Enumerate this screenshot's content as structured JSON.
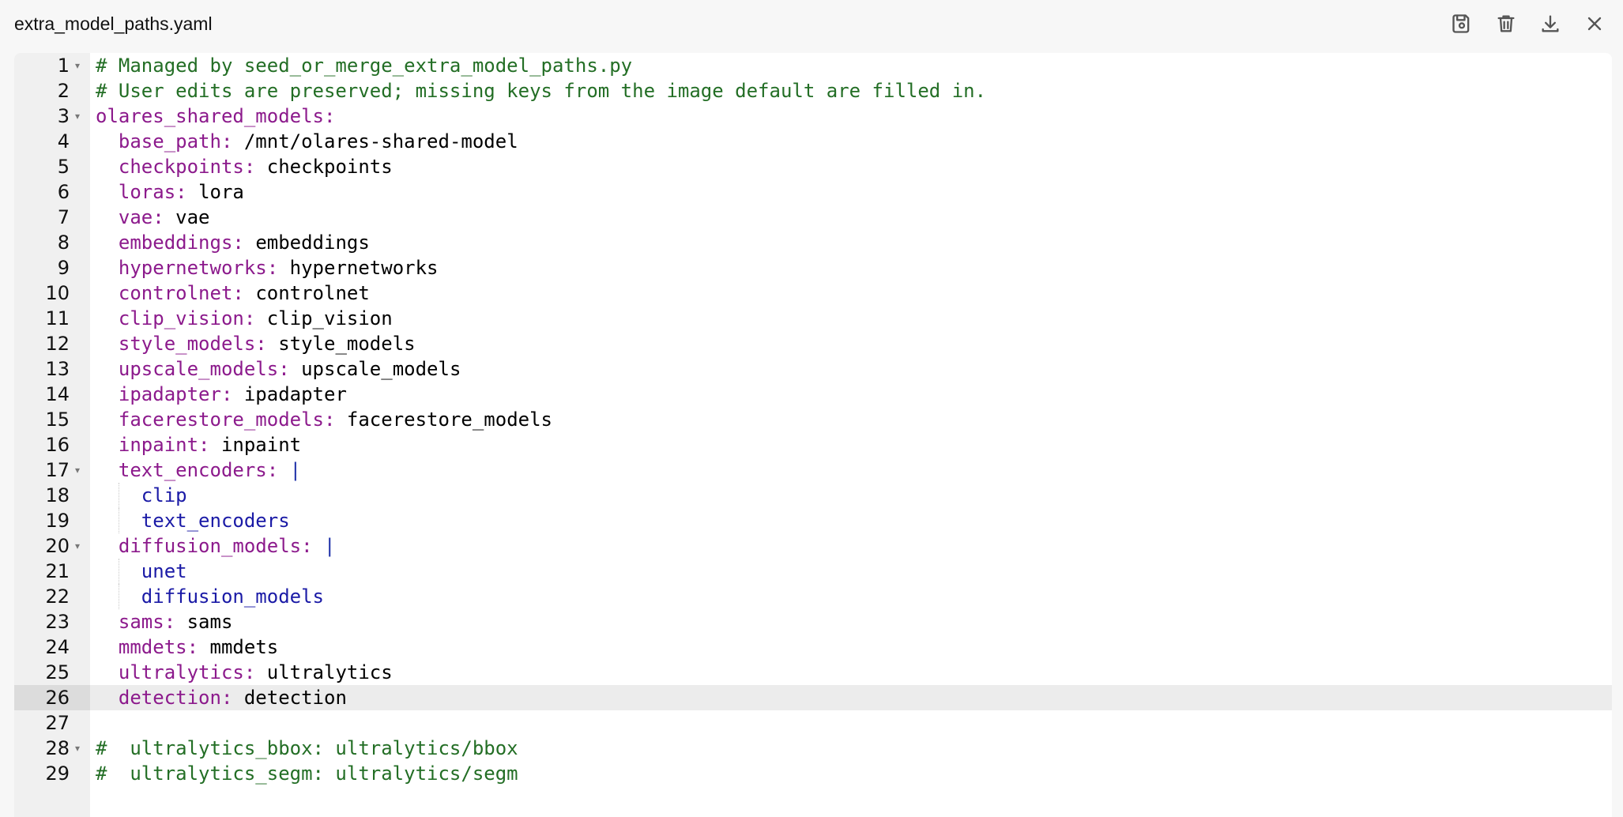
{
  "window": {
    "title": "extra_model_paths.yaml"
  },
  "actions": {
    "save_icon": "save-icon",
    "delete_icon": "trash-icon",
    "download_icon": "download-icon",
    "close_icon": "close-icon"
  },
  "editor": {
    "active_line": 26,
    "lines": [
      {
        "n": "1",
        "fold": true,
        "indent": 0,
        "comment": "# Managed by seed_or_merge_extra_model_paths.py"
      },
      {
        "n": "2",
        "indent": 0,
        "comment": "# User edits are preserved; missing keys from the image default are filled in."
      },
      {
        "n": "3",
        "fold": true,
        "indent": 0,
        "key": "olares_shared_models:"
      },
      {
        "n": "4",
        "indent": 1,
        "key": "base_path:",
        "val": "/mnt/olares-shared-model"
      },
      {
        "n": "5",
        "indent": 1,
        "key": "checkpoints:",
        "val": "checkpoints"
      },
      {
        "n": "6",
        "indent": 1,
        "key": "loras:",
        "val": "lora"
      },
      {
        "n": "7",
        "indent": 1,
        "key": "vae:",
        "val": "vae"
      },
      {
        "n": "8",
        "indent": 1,
        "key": "embeddings:",
        "val": "embeddings"
      },
      {
        "n": "9",
        "indent": 1,
        "key": "hypernetworks:",
        "val": "hypernetworks"
      },
      {
        "n": "10",
        "indent": 1,
        "key": "controlnet:",
        "val": "controlnet"
      },
      {
        "n": "11",
        "indent": 1,
        "key": "clip_vision:",
        "val": "clip_vision"
      },
      {
        "n": "12",
        "indent": 1,
        "key": "style_models:",
        "val": "style_models"
      },
      {
        "n": "13",
        "indent": 1,
        "key": "upscale_models:",
        "val": "upscale_models"
      },
      {
        "n": "14",
        "indent": 1,
        "key": "ipadapter:",
        "val": "ipadapter"
      },
      {
        "n": "15",
        "indent": 1,
        "key": "facerestore_models:",
        "val": "facerestore_models"
      },
      {
        "n": "16",
        "indent": 1,
        "key": "inpaint:",
        "val": "inpaint"
      },
      {
        "n": "17",
        "fold": true,
        "indent": 1,
        "key": "text_encoders:",
        "op": "|"
      },
      {
        "n": "18",
        "indent": 2,
        "block": "clip"
      },
      {
        "n": "19",
        "indent": 2,
        "block": "text_encoders"
      },
      {
        "n": "20",
        "fold": true,
        "indent": 1,
        "key": "diffusion_models:",
        "op": "|"
      },
      {
        "n": "21",
        "indent": 2,
        "block": "unet"
      },
      {
        "n": "22",
        "indent": 2,
        "block": "diffusion_models"
      },
      {
        "n": "23",
        "indent": 1,
        "key": "sams:",
        "val": "sams"
      },
      {
        "n": "24",
        "indent": 1,
        "key": "mmdets:",
        "val": "mmdets"
      },
      {
        "n": "25",
        "indent": 1,
        "key": "ultralytics:",
        "val": "ultralytics"
      },
      {
        "n": "26",
        "indent": 1,
        "key": "detection:",
        "val": "detection"
      },
      {
        "n": "27",
        "indent": 0
      },
      {
        "n": "28",
        "fold": true,
        "indent": 0,
        "comment": "#  ultralytics_bbox: ultralytics/bbox"
      },
      {
        "n": "29",
        "indent": 0,
        "comment": "#  ultralytics_segm: ultralytics/segm"
      }
    ]
  },
  "colors": {
    "comment": "#236e25",
    "key": "#8c1a8c",
    "value": "#000000",
    "block_scalar": "#1a1aa6",
    "active_line": "#ececec"
  }
}
